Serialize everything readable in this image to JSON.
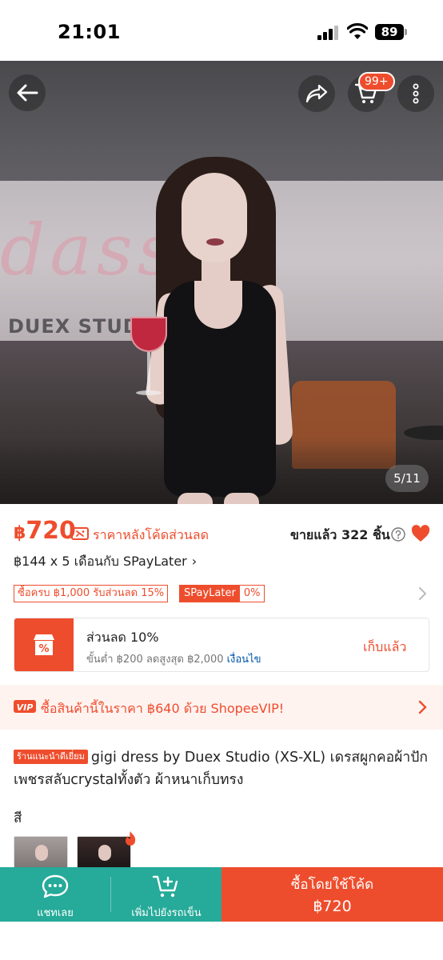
{
  "status_bar": {
    "time": "21:01",
    "battery": "89"
  },
  "header": {
    "cart_badge": "99+",
    "image_counter": "5/11"
  },
  "hero": {
    "background_text": "dassy",
    "studio_text": "DUEX STUDIO"
  },
  "price": {
    "currency": "฿",
    "amount": "720",
    "note": "ราคาหลังโค้ดส่วนลด",
    "sold": "ขายแล้ว 322 ชิ้น",
    "installment": "฿144 x 5 เดือนกับ SPayLater",
    "installment_chevron": "›"
  },
  "promos": {
    "chip1": "ซื้อครบ ฿1,000 รับส่วนลด 15%",
    "chip2_label": "SPayLater",
    "chip2_value": "0%"
  },
  "voucher": {
    "title": "ส่วนลด 10%",
    "subtitle": "ขั้นต่ำ ฿200 ลดสูงสุด ฿2,000",
    "condition_link": "เงื่อนไข",
    "claim": "เก็บแล้ว"
  },
  "vip": {
    "text": "ซื้อสินค้านี้ในราคา ฿640 ด้วย ShopeeVIP!"
  },
  "product": {
    "shop_badge": "ร้านแนะนำดีเยี่ยม",
    "title": "gigi dress by Duex Studio (XS-XL) เดรสผูกคอผ้าปักเพชรสลับcrystalทั้งตัว ผ้าหนาเก็บทรง",
    "color_label": "สี"
  },
  "bottom_bar": {
    "chat": "แชทเลย",
    "add_to_cart": "เพิ่มไปยังรถเข็น",
    "buy_label": "ซื้อโดยใช้โค้ด",
    "buy_price": "฿720"
  },
  "colors": {
    "accent": "#ee4d2d",
    "teal": "#26aa99"
  }
}
